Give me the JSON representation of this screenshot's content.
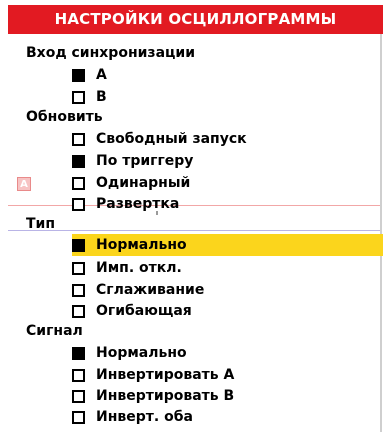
{
  "header": {
    "title": "НАСТРОЙКИ ОСЦИЛЛОГРАММЫ"
  },
  "background": {
    "marker_label": "A"
  },
  "sections": {
    "sync_input": {
      "label": "Вход синхронизации",
      "options": [
        {
          "label": "A",
          "selected": true
        },
        {
          "label": "B",
          "selected": false
        }
      ]
    },
    "update": {
      "label": "Обновить",
      "options": [
        {
          "label": "Свободный запуск",
          "selected": false
        },
        {
          "label": "По триггеру",
          "selected": true
        },
        {
          "label": "Одинарный",
          "selected": false
        },
        {
          "label": "Развертка",
          "selected": false
        }
      ]
    },
    "type": {
      "label": "Тип",
      "options": [
        {
          "label": "Нормально",
          "selected": true,
          "highlighted": true
        },
        {
          "label": "Имп. откл.",
          "selected": false
        },
        {
          "label": "Сглаживание",
          "selected": false
        },
        {
          "label": "Огибающая",
          "selected": false
        }
      ]
    },
    "signal": {
      "label": "Сигнал",
      "options": [
        {
          "label": "Нормально",
          "selected": true
        },
        {
          "label": "Инвертировать A",
          "selected": false
        },
        {
          "label": "Инвертировать B",
          "selected": false
        },
        {
          "label": "Инверт. оба",
          "selected": false
        }
      ]
    }
  },
  "colors": {
    "header_bg": "#e21a22",
    "highlight_bg": "#fbd51c",
    "text": "#000000"
  }
}
